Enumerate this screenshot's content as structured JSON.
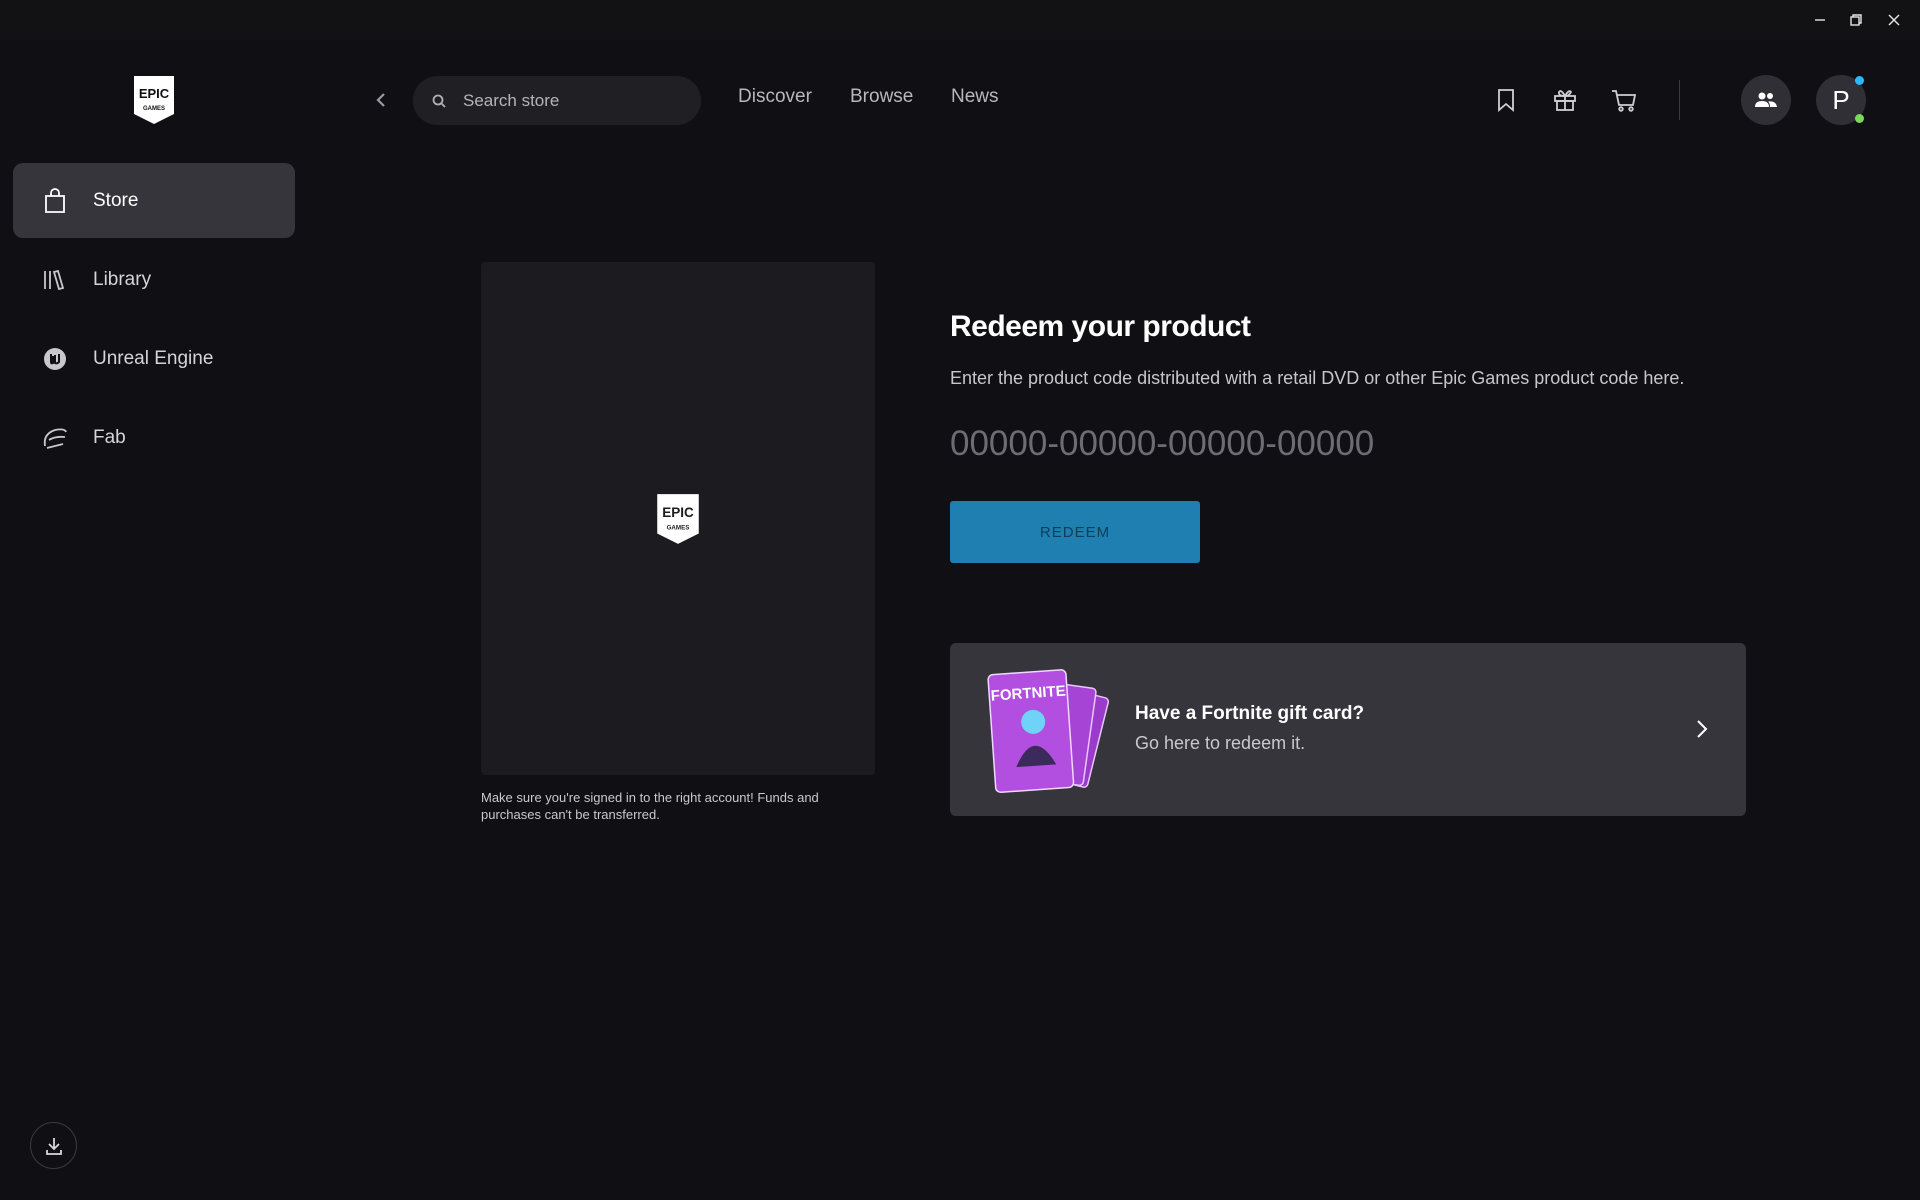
{
  "window": {
    "controls": {
      "minimize_icon": "minimize-icon",
      "restore_icon": "restore-icon",
      "close_icon": "close-icon"
    }
  },
  "sidebar": {
    "logo": {
      "line1": "EPIC",
      "line2": "GAMES"
    },
    "items": [
      {
        "label": "Store",
        "icon": "shopping-bag-icon",
        "active": true
      },
      {
        "label": "Library",
        "icon": "library-icon",
        "active": false
      },
      {
        "label": "Unreal Engine",
        "icon": "unreal-engine-icon",
        "active": false
      },
      {
        "label": "Fab",
        "icon": "fab-icon",
        "active": false
      }
    ],
    "download_icon": "download-icon"
  },
  "topbar": {
    "search": {
      "placeholder": "Search store",
      "value": ""
    },
    "nav": [
      "Discover",
      "Browse",
      "News"
    ],
    "icons": [
      "wishlist-icon",
      "gift-icon",
      "cart-icon"
    ],
    "avatar_initial": "P"
  },
  "main": {
    "panel_logo": {
      "line1": "EPIC",
      "line2": "GAMES"
    },
    "warning": "Make sure you're signed in to the right account! Funds and purchases can't be transferred.",
    "heading": "Redeem your product",
    "subheading": "Enter the product code distributed with a retail DVD or other Epic Games product code here.",
    "code_input": {
      "placeholder": "00000-00000-00000-00000",
      "value": ""
    },
    "redeem_label": "REDEEM",
    "gift_card": {
      "title": "Have a Fortnite gift card?",
      "subtitle": "Go here to redeem it.",
      "art_text": "FORTNITE"
    }
  },
  "colors": {
    "background": "#101014",
    "accent": "#1f7fb0",
    "active_nav": "#35353b",
    "status_online": "#7bd95a",
    "notification": "#26bbff"
  }
}
